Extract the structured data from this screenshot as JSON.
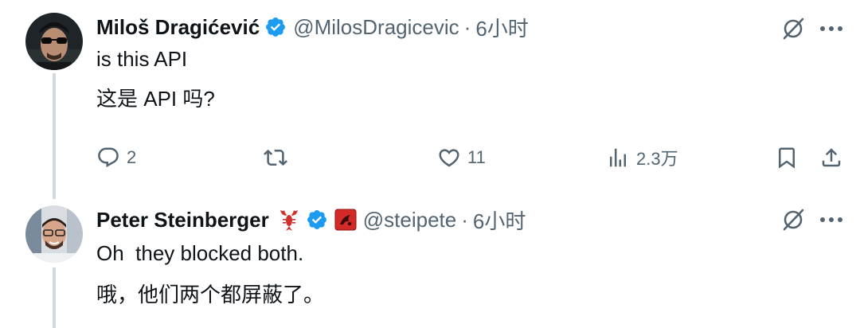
{
  "tweet1": {
    "author_name": "Miloš Dragićević",
    "handle": "@MilosDragicevic",
    "separator": "·",
    "time": "6小时",
    "text_original": "is this API",
    "text_translation": "这是 API 吗?",
    "actions": {
      "replies": "2",
      "retweets": "",
      "likes": "11",
      "views": "2.3万"
    }
  },
  "tweet2": {
    "author_name": "Peter Steinberger",
    "handle": "@steipete",
    "separator": "·",
    "time": "6小时",
    "emoji_badge": "lobster",
    "text_original": "Oh  they blocked both.",
    "text_translation": "哦，他们两个都屏蔽了。"
  },
  "colors": {
    "verified_blue": "#1d9bf0",
    "secondary_text": "#536471",
    "thread_line": "#cfd9de"
  },
  "icons": {
    "translate": "no-translate-icon",
    "more": "more-dots-icon",
    "reply": "reply-icon",
    "retweet": "retweet-icon",
    "like": "heart-icon",
    "views": "views-icon",
    "bookmark": "bookmark-icon",
    "share": "share-icon"
  }
}
